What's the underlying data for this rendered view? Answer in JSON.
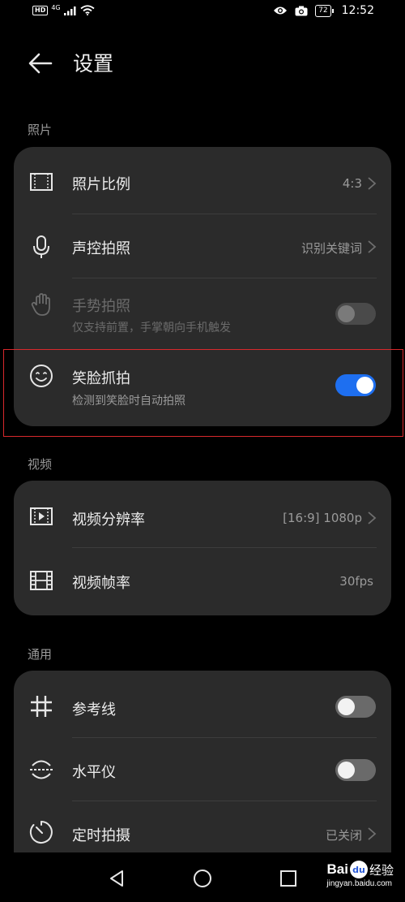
{
  "status_bar": {
    "network": "HD",
    "signal_label": "4G",
    "battery": "72",
    "time": "12:52"
  },
  "header": {
    "title": "设置"
  },
  "photo_section": {
    "label": "照片",
    "items": [
      {
        "icon": "aspect-ratio-icon",
        "label": "照片比例",
        "value": "4:3"
      },
      {
        "icon": "microphone-icon",
        "label": "声控拍照",
        "value": "识别关键词"
      },
      {
        "icon": "hand-gesture-icon",
        "label": "手势拍照",
        "subtitle": "仅支持前置，手掌朝向手机触发",
        "toggle": false,
        "disabled": true
      },
      {
        "icon": "smile-icon",
        "label": "笑脸抓拍",
        "subtitle": "检测到笑脸时自动拍照",
        "toggle": true
      }
    ]
  },
  "video_section": {
    "label": "视频",
    "items": [
      {
        "icon": "video-resolution-icon",
        "label": "视频分辨率",
        "value": "[16:9] 1080p"
      },
      {
        "icon": "film-icon",
        "label": "视频帧率",
        "value": "30fps"
      }
    ]
  },
  "general_section": {
    "label": "通用",
    "items": [
      {
        "icon": "grid-hash-icon",
        "label": "参考线",
        "toggle": false
      },
      {
        "icon": "level-icon",
        "label": "水平仪",
        "toggle": false
      },
      {
        "icon": "timer-icon",
        "label": "定时拍摄",
        "value": "已关闭"
      }
    ]
  },
  "watermark": {
    "brand_left": "Bai",
    "brand_mid": "du",
    "brand_right": "经验",
    "url": "jingyan.baidu.com"
  },
  "colors": {
    "background": "#000000",
    "card": "#2b2b2b",
    "accent": "#1e6ff0",
    "highlight_box": "#d8282c"
  }
}
